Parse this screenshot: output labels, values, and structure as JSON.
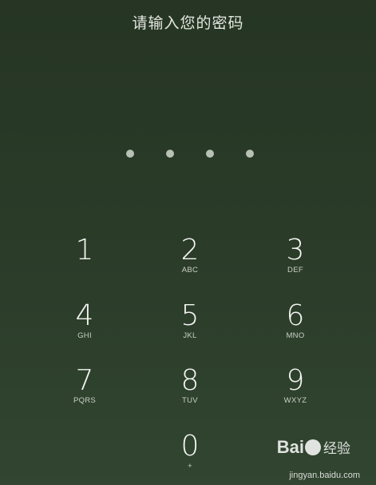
{
  "prompt": "请输入您的密码",
  "pin_entered_count": 4,
  "keypad": [
    {
      "digit": "1",
      "letters": ""
    },
    {
      "digit": "2",
      "letters": "ABC"
    },
    {
      "digit": "3",
      "letters": "DEF"
    },
    {
      "digit": "4",
      "letters": "GHI"
    },
    {
      "digit": "5",
      "letters": "JKL"
    },
    {
      "digit": "6",
      "letters": "MNO"
    },
    {
      "digit": "7",
      "letters": "PQRS"
    },
    {
      "digit": "8",
      "letters": "TUV"
    },
    {
      "digit": "9",
      "letters": "WXYZ"
    },
    {
      "digit": "0",
      "letters": "+"
    }
  ],
  "watermark": {
    "logo_text_1": "Bai",
    "logo_text_2": "经验",
    "url": "jingyan.baidu.com"
  },
  "colors": {
    "background_top": "#263524",
    "background_bottom": "#314530",
    "dot": "#b8c1b5",
    "text": "#f4f6f3"
  }
}
